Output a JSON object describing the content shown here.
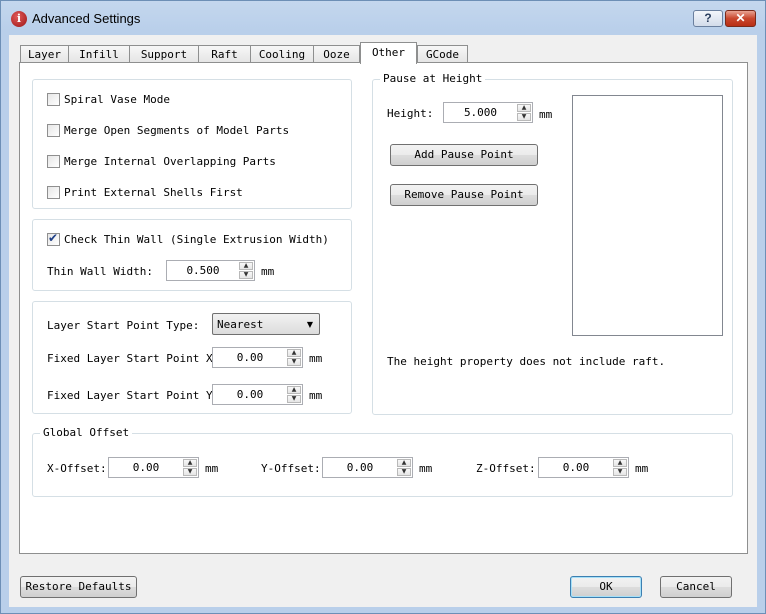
{
  "window": {
    "title": "Advanced Settings",
    "help_label": "?",
    "close_label": "✕",
    "app_icon_glyph": "i"
  },
  "tabs": [
    "Layer",
    "Infill",
    "Support",
    "Raft",
    "Cooling",
    "Ooze",
    "Other",
    "GCode"
  ],
  "active_tab": "Other",
  "misc": {
    "spiral_vase": {
      "label": "Spiral Vase Mode",
      "checked": false
    },
    "merge_open": {
      "label": "Merge Open Segments of Model Parts",
      "checked": false
    },
    "merge_internal": {
      "label": "Merge Internal Overlapping Parts",
      "checked": false
    },
    "print_external": {
      "label": "Print External Shells First",
      "checked": false
    }
  },
  "thin_wall": {
    "check_label": "Check Thin Wall (Single Extrusion Width)",
    "checked": true,
    "width_label": "Thin Wall Width:",
    "width_value": "0.500",
    "unit": "mm"
  },
  "layer_start": {
    "type_label": "Layer Start Point Type:",
    "type_value": "Nearest",
    "x_label": "Fixed Layer Start Point X:",
    "x_value": "0.00",
    "y_label": "Fixed Layer Start Point Y:",
    "y_value": "0.00",
    "unit": "mm"
  },
  "pause": {
    "title": "Pause at Height",
    "height_label": "Height:",
    "height_value": "5.000",
    "unit": "mm",
    "add_label": "Add Pause Point",
    "remove_label": "Remove Pause Point",
    "note": "The height property does not include raft."
  },
  "global_offset": {
    "title": "Global Offset",
    "x_label": "X-Offset:",
    "x_value": "0.00",
    "y_label": "Y-Offset:",
    "y_value": "0.00",
    "z_label": "Z-Offset:",
    "z_value": "0.00",
    "unit": "mm"
  },
  "footer": {
    "restore_label": "Restore Defaults",
    "ok_label": "OK",
    "cancel_label": "Cancel"
  },
  "icons": {
    "spin_up": "▲",
    "spin_down": "▼",
    "combo_arrow": "▼"
  }
}
